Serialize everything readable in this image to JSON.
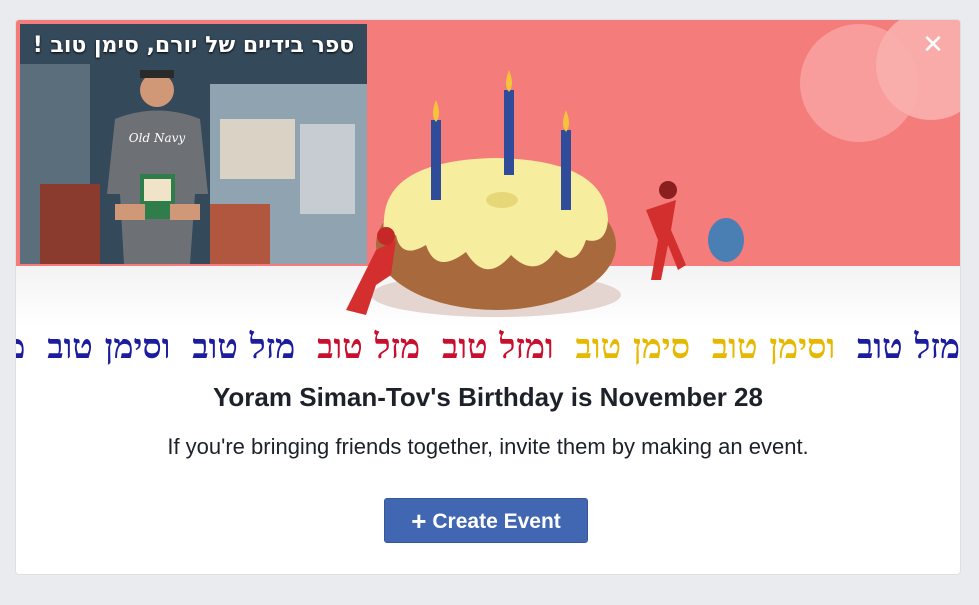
{
  "dialog": {
    "close_icon": "close-icon",
    "photo_caption": "ספר בידיים של יורם, סימן טוב !",
    "mazal_line": [
      {
        "text": "מזל טוב",
        "color": "#1c1c9e"
      },
      {
        "text": "וסימן טוב",
        "color": "#e6b800"
      },
      {
        "text": "מזל טוב",
        "color": "#e6b800"
      },
      {
        "text": "מזל טוב",
        "color": "#c8102e"
      },
      {
        "text": "ומזל טוב",
        "color": "#c8102e"
      },
      {
        "text": "סימן טוב",
        "color": "#1c1c9e"
      },
      {
        "text": "וסימן טוב",
        "color": "#1c1c9e"
      },
      {
        "text": "מזל טוב",
        "color": "#1c1c9e"
      }
    ],
    "title": "Yoram Siman-Tov's Birthday is November 28",
    "subtitle": "If you're bringing friends together, invite them by making an event.",
    "create_button": {
      "label": "Create Event",
      "icon": "plus-icon"
    },
    "colors": {
      "banner": "#f47c7b",
      "button": "#4267b2"
    }
  }
}
